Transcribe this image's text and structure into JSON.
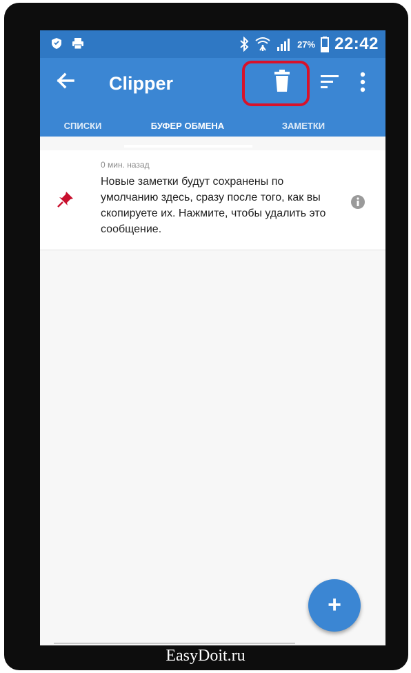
{
  "status_bar": {
    "battery": "27%",
    "time": "22:42",
    "icons": [
      "shield-icon",
      "printer-icon",
      "bluetooth-icon",
      "wifi-icon",
      "signal-icon",
      "battery-icon"
    ]
  },
  "app_bar": {
    "title": "Clipper",
    "back_icon": "arrow-left-icon",
    "actions": [
      "trash-icon",
      "sort-icon",
      "more-vert-icon"
    ]
  },
  "tabs": [
    {
      "label": "СПИСКИ",
      "active": false
    },
    {
      "label": "БУФЕР ОБМЕНА",
      "active": true
    },
    {
      "label": "ЗАМЕТКИ",
      "active": false
    }
  ],
  "notes": [
    {
      "time": "0 мин. назад",
      "text": "Новые заметки будут сохранены по умолчанию здесь, сразу после того, как вы скопируете их. Нажмите, чтобы удалить это сообщение.",
      "pinned": true
    }
  ],
  "fab": {
    "label": "+"
  },
  "colors": {
    "primary": "#3b86d3",
    "status": "#2f78c4",
    "highlight": "#d8122a",
    "pin": "#c8102e"
  },
  "watermark": "EasyDoit.ru"
}
